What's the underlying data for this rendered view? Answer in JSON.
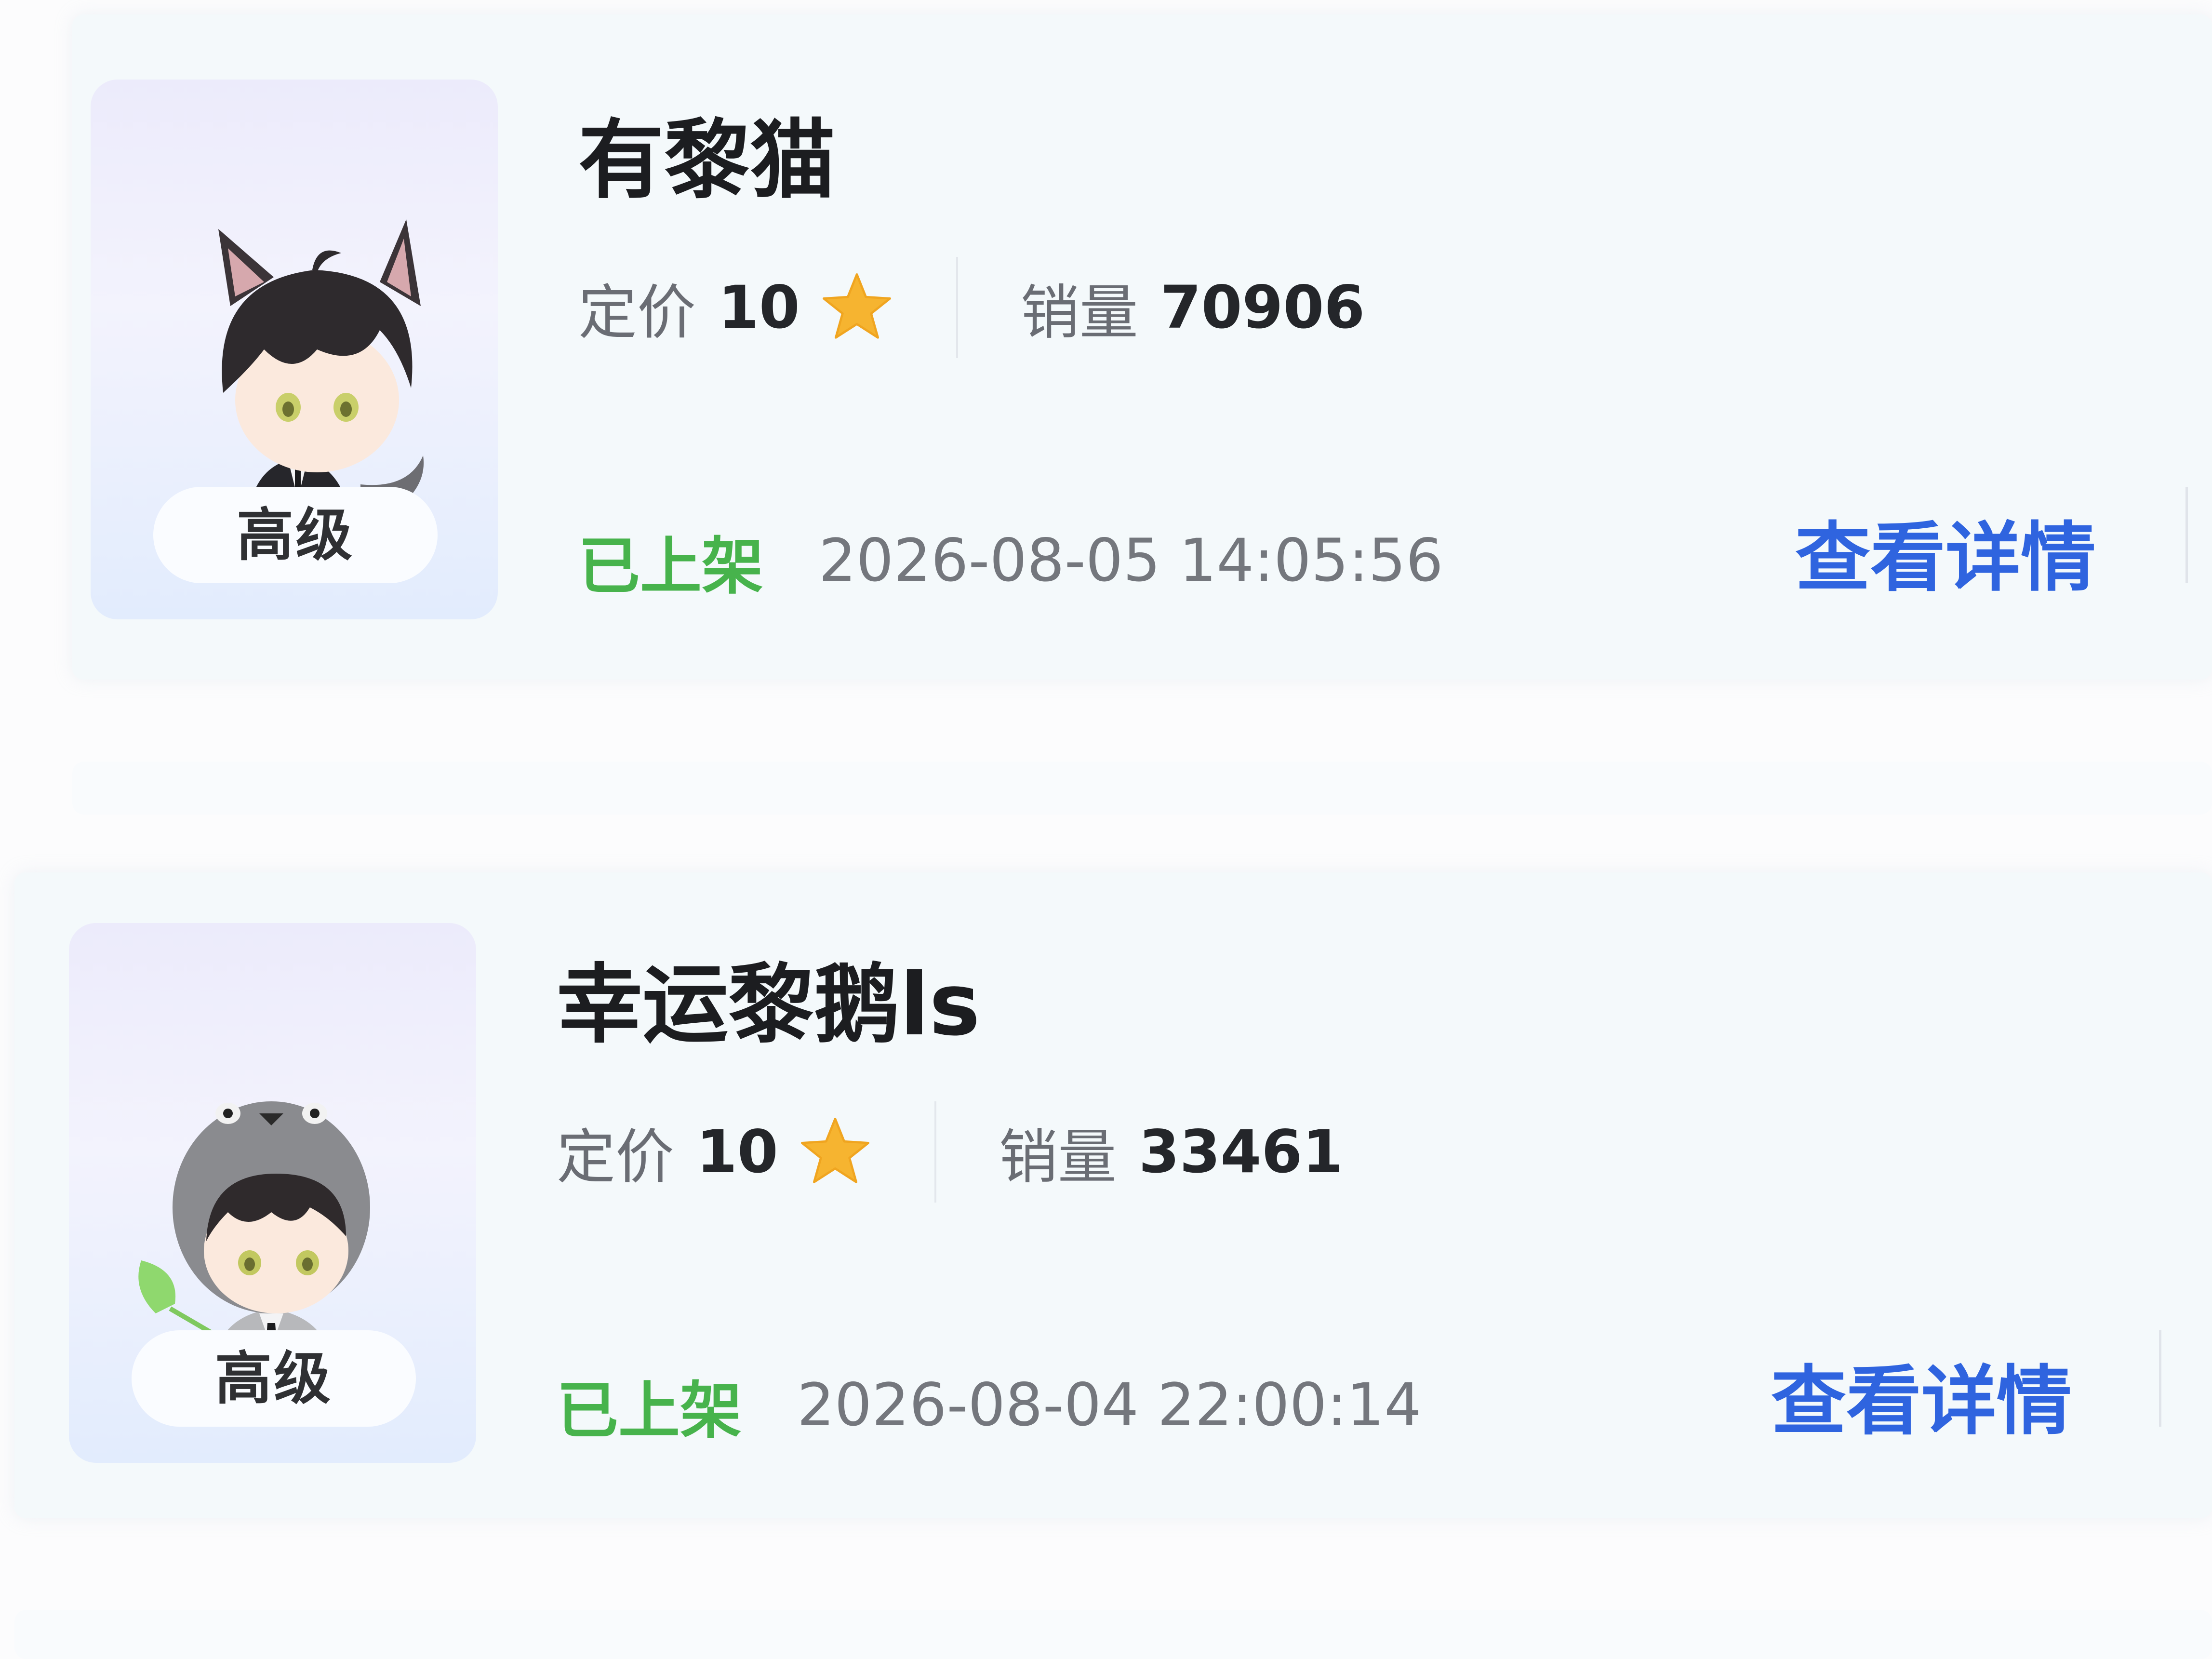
{
  "items": [
    {
      "title": "有黎猫",
      "level": "高级",
      "price_label": "定价",
      "price": "10",
      "sales_label": "销量",
      "sales": "70906",
      "status": "已上架",
      "time": "2026-08-05 14:05:56",
      "detail_label": "查看详情",
      "avatar_icon": "cat-boy-avatar"
    },
    {
      "title": "幸运黎鹅ls",
      "level": "高级",
      "price_label": "定价",
      "price": "10",
      "sales_label": "销量",
      "sales": "33461",
      "status": "已上架",
      "time": "2026-08-04 22:00:14",
      "detail_label": "查看详情",
      "avatar_icon": "penguin-hood-avatar"
    }
  ],
  "colors": {
    "status_green": "#47b34c",
    "link_blue": "#2f64df",
    "star": "#f6b430"
  }
}
